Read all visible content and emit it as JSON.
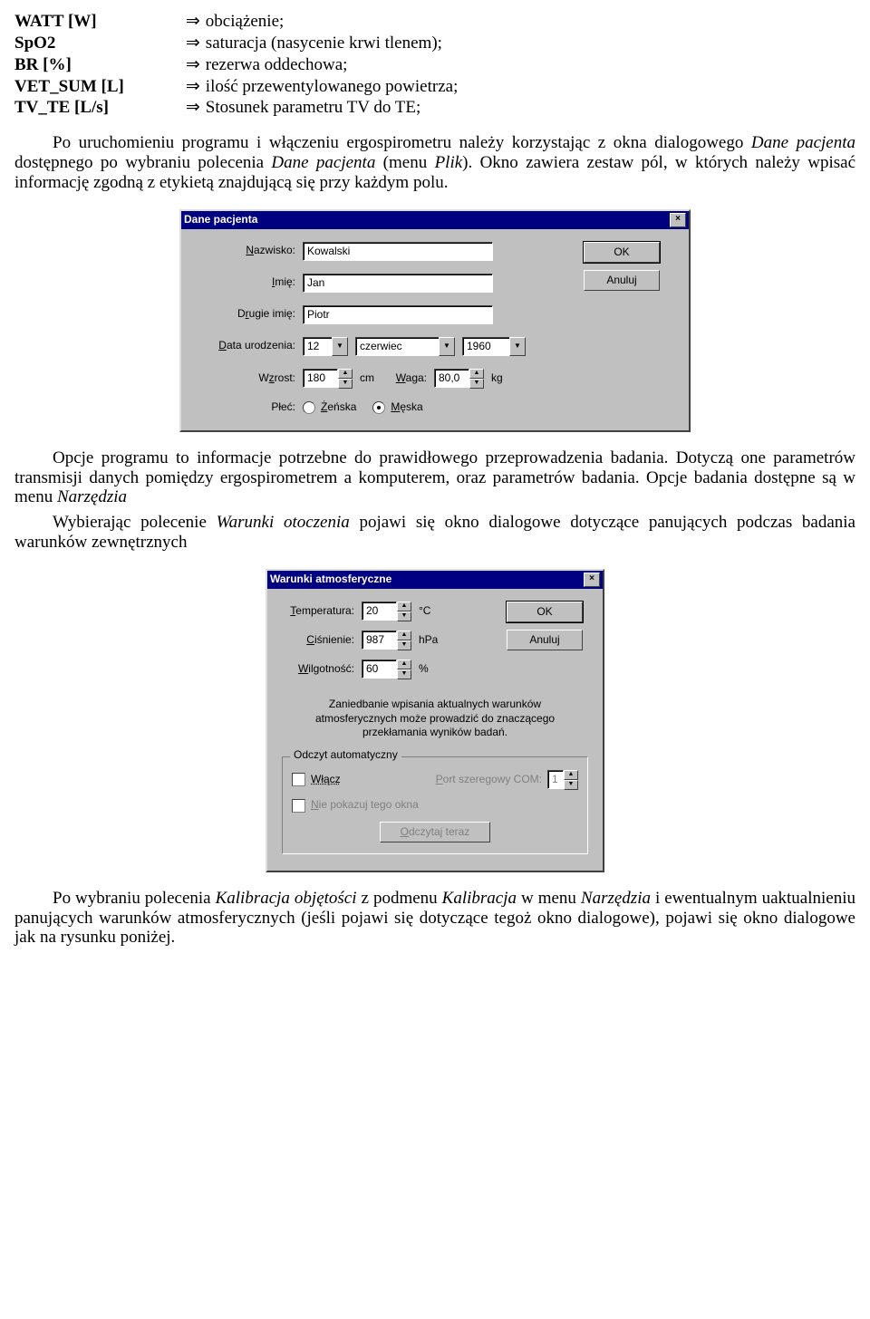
{
  "defs": [
    {
      "key": "WATT [W]",
      "val": "obciążenie;"
    },
    {
      "key": "SpO2",
      "val": "saturacja (nasycenie krwi tlenem);"
    },
    {
      "key": "BR [%]",
      "val": "rezerwa oddechowa;"
    },
    {
      "key": "VET_SUM [L]",
      "val": "ilość przewentylowanego powietrza;"
    },
    {
      "key": "TV_TE [L/s]",
      "val": "Stosunek parametru TV do TE;"
    }
  ],
  "para1a": "Po uruchomieniu programu i włączeniu ergospirometru należy korzystając z okna dialogowego ",
  "para1b": "Dane pacjenta",
  "para1c": " dostępnego po wybraniu polecenia ",
  "para1d": "Dane pacjenta",
  "para1e": " (menu ",
  "para1f": "Plik",
  "para1g": "). Okno zawiera zestaw pól, w których należy wpisać informację zgodną z etykietą znajdującą się przy każdym polu.",
  "dlg1": {
    "title": "Dane pacjenta",
    "labels": {
      "nazwisko": "Nazwisko:",
      "imie": "Imię:",
      "drugie": "Drugie imię:",
      "data": "Data urodzenia:",
      "wzrost": "Wzrost:",
      "waga": "Waga:",
      "plec": "Płeć:"
    },
    "values": {
      "nazwisko": "Kowalski",
      "imie": "Jan",
      "drugie": "Piotr",
      "day": "12",
      "month": "czerwiec",
      "year": "1960",
      "wzrost": "180",
      "waga": "80,0"
    },
    "units": {
      "cm": "cm",
      "kg": "kg"
    },
    "radios": {
      "f": "Żeńska",
      "m": "Męska"
    },
    "ok": "OK",
    "cancel": "Anuluj"
  },
  "para2a": "Opcje programu to informacje potrzebne do prawidłowego przeprowadzenia badania. Dotyczą one parametrów transmisji danych pomiędzy ergospirometrem a komputerem, oraz parametrów badania. Opcje badania dostępne są w menu ",
  "para2b": "Narzędzia",
  "para3a": "Wybierając polecenie ",
  "para3b": "Warunki otoczenia",
  "para3c": " pojawi się okno dialogowe dotyczące panujących podczas badania warunków zewnętrznych",
  "dlg2": {
    "title": "Warunki atmosferyczne",
    "labels": {
      "temp": "Temperatura:",
      "cis": "Ciśnienie:",
      "wilg": "Wilgotność:"
    },
    "values": {
      "temp": "20",
      "cis": "987",
      "wilg": "60"
    },
    "units": {
      "c": "°C",
      "hpa": "hPa",
      "pct": "%"
    },
    "ok": "OK",
    "cancel": "Anuluj",
    "note": "Zaniedbanie wpisania aktualnych warunków atmosferycznych może prowadzić do znaczącego przekłamania wyników badań.",
    "group": "Odczyt automatyczny",
    "wlacz": "Włącz",
    "niepokazuj": "Nie pokazuj tego okna",
    "comlbl": "Port szeregowy COM:",
    "comval": "1",
    "odczytaj": "Odczytaj teraz"
  },
  "para4a": "Po wybraniu polecenia ",
  "para4b": "Kalibracja objętości",
  "para4c": " z podmenu ",
  "para4d": "Kalibracja",
  "para4e": " w menu ",
  "para4f": "Narzędzia",
  "para4g": " i ewentualnym uaktualnieniu panujących warunków atmosferycznych (jeśli pojawi się dotyczące tegoż okno dialogowe), pojawi się okno dialogowe jak na rysunku poniżej."
}
